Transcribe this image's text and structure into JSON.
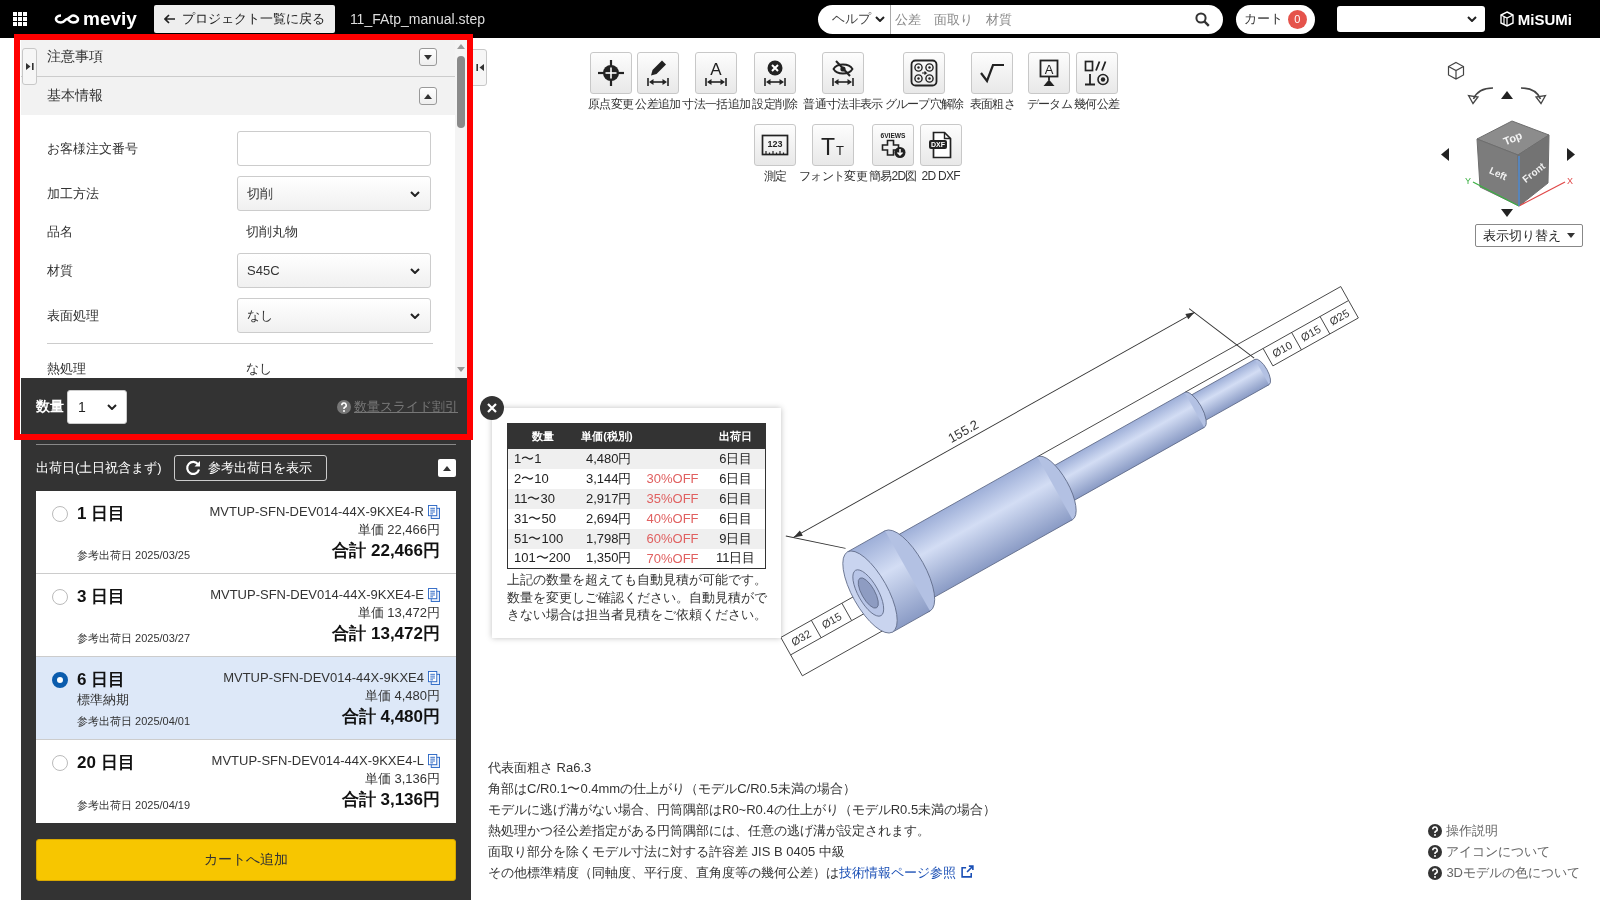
{
  "topbar": {
    "brand": "meviy",
    "back_button": "プロジェクト一覧に戻る",
    "file_name": "11_FAtp_manual.step",
    "search": {
      "scope": "ヘルプ",
      "placeholder": "公差　面取り　材質"
    },
    "cart": {
      "label": "カート",
      "count": "0"
    },
    "company_logo": "MiSUMi"
  },
  "order_panel": {
    "sections": [
      {
        "title": "注意事項",
        "expanded": false
      },
      {
        "title": "基本情報",
        "expanded": true,
        "field_groups": [
          {
            "fields": [
              {
                "kind": "input",
                "label": "お客様注文番号"
              },
              {
                "kind": "select",
                "label": "加工方法",
                "value": "切削"
              },
              {
                "kind": "text",
                "label": "品名",
                "value": "切削丸物"
              },
              {
                "kind": "select",
                "label": "材質",
                "value": "S45C"
              },
              {
                "kind": "select",
                "label": "表面処理",
                "value": "なし"
              }
            ]
          },
          {
            "fields": [
              {
                "kind": "text",
                "label": "熱処理",
                "value": "なし"
              }
            ]
          }
        ]
      }
    ],
    "quantity": {
      "label": "数量",
      "value": "1"
    },
    "discount_link": "数量スライド割引"
  },
  "shipping": {
    "title": "出荷日(土日祝含まず)",
    "reference_button": "参考出荷日を表示",
    "expanded": true,
    "options": [
      {
        "days": "1 日目",
        "reference_date": "参考出荷日 2025/03/25",
        "part_number": "MVTUP-SFN-DEV014-44X-9KXE4-R",
        "unit_price": "単価 22,466円",
        "total": "合計 22,466円",
        "selected": false
      },
      {
        "days": "3 日目",
        "reference_date": "参考出荷日 2025/03/27",
        "part_number": "MVTUP-SFN-DEV014-44X-9KXE4-E",
        "unit_price": "単価 13,472円",
        "total": "合計 13,472円",
        "selected": false
      },
      {
        "days": "6 日目",
        "note": "標準納期",
        "reference_date": "参考出荷日 2025/04/01",
        "part_number": "MVTUP-SFN-DEV014-44X-9KXE4",
        "unit_price": "単価 4,480円",
        "total": "合計 4,480円",
        "selected": true
      },
      {
        "days": "20 日目",
        "reference_date": "参考出荷日 2025/04/19",
        "part_number": "MVTUP-SFN-DEV014-44X-9KXE4-L",
        "unit_price": "単価 3,136円",
        "total": "合計 3,136円",
        "selected": false
      }
    ],
    "add_to_cart": "カートへ追加"
  },
  "viewer": {
    "toolbar": {
      "rows": [
        {
          "groups": [
            {
              "tools": [
                {
                  "kind": "origin",
                  "label": "原点変更"
                },
                {
                  "kind": "tolerance",
                  "label": "公差追加"
                },
                {
                  "kind": "bulk_dimension",
                  "label": "寸法一括追加",
                  "icon_texts": [
                    "A"
                  ]
                },
                {
                  "kind": "delete_setting",
                  "label": "設定削除"
                }
              ]
            },
            {
              "tools": [
                {
                  "kind": "hide_dimension",
                  "label": "普通寸法非表示"
                },
                {
                  "kind": "ungroup_holes",
                  "label": "グループ穴解除"
                }
              ]
            },
            {
              "tools": [
                {
                  "kind": "roughness",
                  "label": "表面粗さ"
                }
              ]
            },
            {
              "tools": [
                {
                  "kind": "datum",
                  "label": "データム",
                  "icon_texts": [
                    "A"
                  ]
                },
                {
                  "kind": "geometric",
                  "label": "幾何公差"
                }
              ]
            }
          ]
        },
        {
          "groups": [
            {
              "tools": [
                {
                  "kind": "measure",
                  "label": "測定",
                  "icon_texts": [
                    "123"
                  ]
                },
                {
                  "kind": "font",
                  "label": "フォント変更",
                  "icon_texts": [
                    "T",
                    "T"
                  ]
                },
                {
                  "kind": "simple_2d",
                  "label": "簡易2D図",
                  "icon_texts": [
                    "6VIEWS"
                  ]
                },
                {
                  "kind": "dxf",
                  "label": "2D DXF",
                  "icon_texts": [
                    "DXF"
                  ]
                }
              ]
            }
          ]
        }
      ]
    },
    "view_cube": {
      "faces": [
        "Top",
        "Left",
        "Front"
      ],
      "axes": [
        "Y",
        "X"
      ],
      "view_button": "表示切り替え"
    },
    "model": {
      "length": "155.2",
      "end_diameters": [
        "Ø10",
        "Ø15",
        "Ø25"
      ],
      "start_diameters": [
        "Ø15",
        "Ø32"
      ]
    },
    "price_popup": {
      "header": {
        "quantity": "数量",
        "unit_price": "単価(税別)",
        "ship_day": "出荷日"
      },
      "rows": [
        {
          "quantity": "1〜1",
          "unit_price": "4,480円",
          "ship_day": "6日目"
        },
        {
          "quantity": "2〜10",
          "unit_price": "3,144円",
          "discount": "30%OFF",
          "ship_day": "6日目"
        },
        {
          "quantity": "11〜30",
          "unit_price": "2,917円",
          "discount": "35%OFF",
          "ship_day": "6日目"
        },
        {
          "quantity": "31〜50",
          "unit_price": "2,694円",
          "discount": "40%OFF",
          "ship_day": "6日目"
        },
        {
          "quantity": "51〜100",
          "unit_price": "1,798円",
          "discount": "60%OFF",
          "ship_day": "9日目"
        },
        {
          "quantity": "101〜200",
          "unit_price": "1,350円",
          "discount": "70%OFF",
          "ship_day": "11日目"
        }
      ],
      "note": "上記の数量を超えても自動見積が可能です。数量を変更しご確認ください。自動見積ができない場合は担当者見積をご依頼ください。"
    },
    "notes": [
      {
        "text": "代表面粗さ Ra6.3"
      },
      {
        "text": "角部はC/R0.1〜0.4mmの仕上がり（モデルC/R0.5未満の場合）"
      },
      {
        "text": "モデルに逃げ溝がない場合、円筒隅部はR0~R0.4の仕上がり（モデルR0.5未満の場合）"
      },
      {
        "text": "熱処理かつ径公差指定がある円筒隅部には、任意の逃げ溝が設定されます。"
      },
      {
        "text": "面取り部分を除くモデル寸法に対する許容差 JIS B 0405 中級"
      },
      {
        "text": "その他標準精度（同軸度、平行度、直角度等の幾何公差）は",
        "link": "技術情報ページ参照"
      }
    ],
    "help_links": [
      {
        "label": "操作説明"
      },
      {
        "label": "アイコンについて"
      },
      {
        "label": "3Dモデルの色について"
      }
    ]
  }
}
